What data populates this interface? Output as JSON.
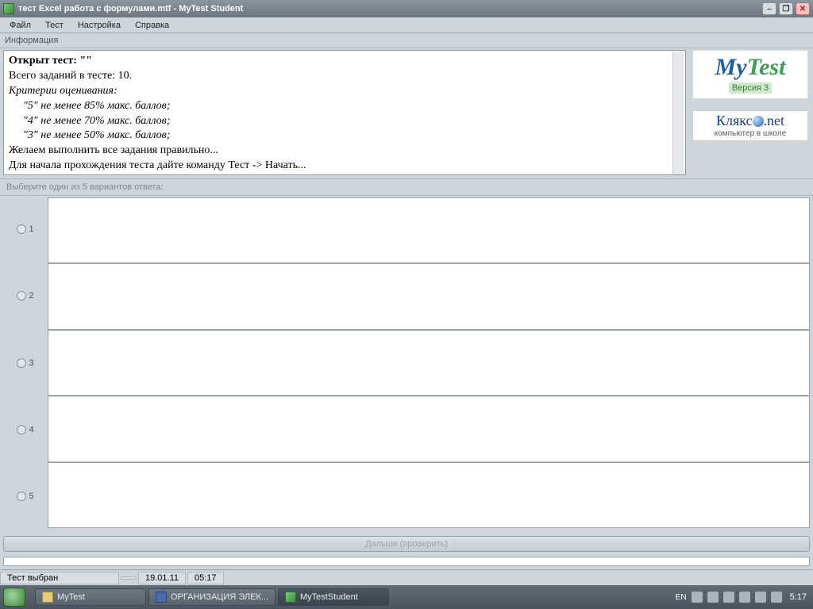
{
  "window": {
    "title": "тест Excel работа с формулами.mtf - MyTest Student"
  },
  "menu": {
    "file": "Файл",
    "test": "Тест",
    "settings": "Настройка",
    "help": "Справка"
  },
  "info": {
    "label": "Информация",
    "line1_a": "Открыт тест: ",
    "line1_b": "\"\"",
    "line2": "Всего заданий в тесте: 10.",
    "line3": "Критерии оценивания:",
    "line4": "\"5\" не менее 85% макс. баллов;",
    "line5": "\"4\" не менее 70% макс. баллов;",
    "line6": "\"3\" не менее 50% макс. баллов;",
    "line7": "Желаем выполнить все задания правильно...",
    "line8": "Для начала прохождения теста дайте команду Тест -> Начать..."
  },
  "logo": {
    "my": "My",
    "test": "Test",
    "version": "Версия 3",
    "klyakso": "Клякс",
    "net": ".net",
    "sub": "компьютер в школе"
  },
  "answers": {
    "prompt": "Выберите один из 5 вариантов ответа:",
    "n1": "1",
    "n2": "2",
    "n3": "3",
    "n4": "4",
    "n5": "5"
  },
  "buttons": {
    "next": "Дальше (проверить)"
  },
  "status": {
    "selected": "Тест выбран",
    "date": "19.01.11",
    "time": "05:17"
  },
  "taskbar": {
    "t1": "MyTest",
    "t2": "ОРГАНИЗАЦИЯ ЭЛЕК...",
    "t3": "MyTestStudent",
    "lang": "EN",
    "clock": "5:17"
  }
}
